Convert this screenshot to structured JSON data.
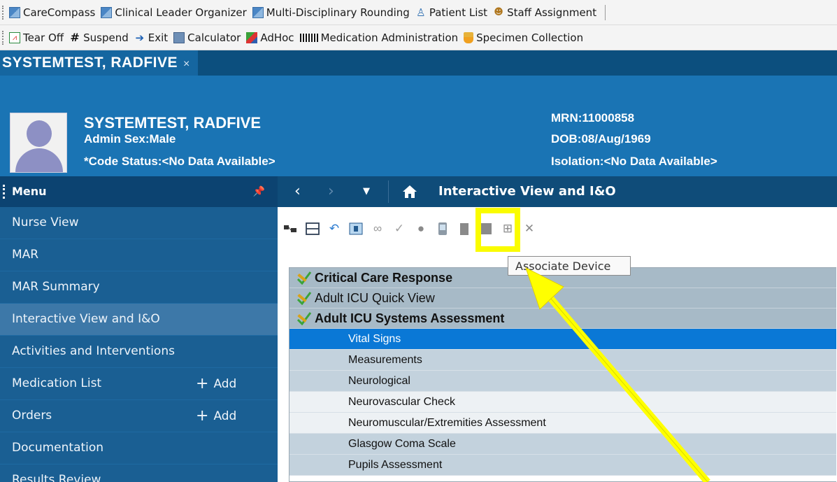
{
  "toolbar1": {
    "items": [
      "CareCompass",
      "Clinical Leader Organizer",
      "Multi-Disciplinary Rounding",
      "Patient List",
      "Staff Assignment"
    ]
  },
  "toolbar2": {
    "items": [
      "Tear Off",
      "Suspend",
      "Exit",
      "Calculator",
      "AdHoc",
      "Medication Administration",
      "Specimen Collection"
    ]
  },
  "tab": {
    "label": "SYSTEMTEST, RADFIVE",
    "close": "×"
  },
  "patient": {
    "name": "SYSTEMTEST, RADFIVE",
    "sex": "Admin Sex:Male",
    "code_status": "*Code Status:<No Data Available>",
    "mrn": "MRN:11000858",
    "dob": "DOB:08/Aug/1969",
    "isolation": "Isolation:<No Data Available>"
  },
  "menu": {
    "title": "Menu",
    "items": [
      {
        "label": "Nurse View"
      },
      {
        "label": "MAR"
      },
      {
        "label": "MAR Summary"
      },
      {
        "label": "Interactive View and I&O",
        "active": true
      },
      {
        "label": "Activities and Interventions"
      },
      {
        "label": "Medication List",
        "add": "Add"
      },
      {
        "label": "Orders",
        "add": "Add"
      },
      {
        "label": "Documentation"
      },
      {
        "label": "Results Review"
      }
    ]
  },
  "nav": {
    "title": "Interactive View and I&O"
  },
  "tooltip": "Associate Device",
  "grid": {
    "sections": [
      "Critical Care Response",
      "Adult ICU Quick View",
      "Adult ICU Systems Assessment"
    ],
    "rows": [
      "Vital Signs",
      "Measurements",
      "Neurological",
      "Neurovascular Check",
      "Neuromuscular/Extremities Assessment",
      "Glasgow Coma Scale",
      "Pupils Assessment"
    ]
  },
  "colors": {
    "banner": "#1a74b4",
    "sidebar": "#1a5f93",
    "selected_row": "#0a78d6",
    "highlight": "#fafc00"
  }
}
